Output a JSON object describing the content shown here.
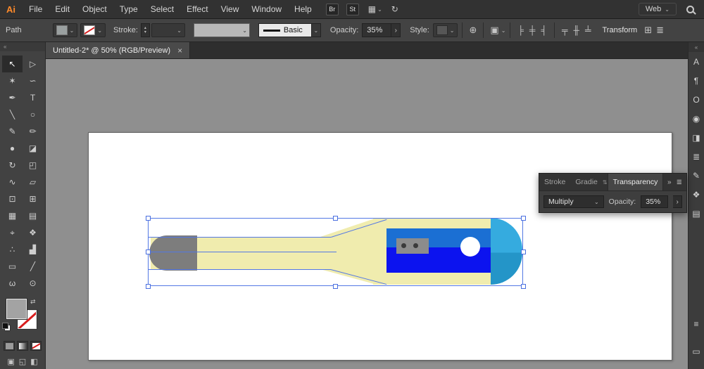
{
  "colors": {
    "ui_dark": "#323232",
    "ui_mid": "#434343",
    "canvas_bg": "#8f8f8f",
    "logo_orange": "#ff8a2a",
    "selection_blue": "#5378e4"
  },
  "glyphs": {
    "chevron_down": "⌄",
    "chevron_right": "›",
    "collapse_left": "«",
    "overflow_right": "»",
    "panel_menu": "≣",
    "up_arrow": "▴",
    "down_arrow": "▾",
    "swap": "⇄",
    "grid": "▦",
    "sync": "↻",
    "globe": "⊕",
    "select_similar": "▣",
    "tab_scroll": "⇅",
    "align": [
      "╞",
      "╪",
      "╡",
      "╤",
      "╫",
      "╧"
    ],
    "transform_grid": "⊞",
    "draw_modes": [
      "▣",
      "◱",
      "◧"
    ]
  },
  "menubar": {
    "logo": "Ai",
    "items": [
      "File",
      "Edit",
      "Object",
      "Type",
      "Select",
      "Effect",
      "View",
      "Window",
      "Help"
    ],
    "bridge_label": "Br",
    "stock_label": "St",
    "workspace": "Web"
  },
  "controlbar": {
    "selection_type": "Path",
    "stroke_label": "Stroke:",
    "brush_name": "Basic",
    "opacity_label": "Opacity:",
    "opacity_value": "35%",
    "style_label": "Style:",
    "transform_label": "Transform"
  },
  "tabbar": {
    "title": "Untitled-2* @ 50% (RGB/Preview)",
    "close": "×"
  },
  "toolbar": {
    "tools": [
      {
        "name": "selection-tool",
        "glyph": "↖"
      },
      {
        "name": "direct-selection-tool",
        "glyph": "▷"
      },
      {
        "name": "magic-wand-tool",
        "glyph": "✶"
      },
      {
        "name": "lasso-tool",
        "glyph": "∽"
      },
      {
        "name": "pen-tool",
        "glyph": "✒"
      },
      {
        "name": "type-tool",
        "glyph": "T"
      },
      {
        "name": "line-segment-tool",
        "glyph": "╲"
      },
      {
        "name": "ellipse-tool",
        "glyph": "○"
      },
      {
        "name": "paintbrush-tool",
        "glyph": "✎"
      },
      {
        "name": "pencil-tool",
        "glyph": "✏"
      },
      {
        "name": "blob-brush-tool",
        "glyph": "●"
      },
      {
        "name": "eraser-tool",
        "glyph": "◪"
      },
      {
        "name": "rotate-tool",
        "glyph": "↻"
      },
      {
        "name": "scale-tool",
        "glyph": "◰"
      },
      {
        "name": "width-tool",
        "glyph": "∿"
      },
      {
        "name": "free-transform-tool",
        "glyph": "▱"
      },
      {
        "name": "shape-builder-tool",
        "glyph": "⊡"
      },
      {
        "name": "perspective-grid-tool",
        "glyph": "⊞"
      },
      {
        "name": "mesh-tool",
        "glyph": "▦"
      },
      {
        "name": "gradient-tool",
        "glyph": "▤"
      },
      {
        "name": "eyedropper-tool",
        "glyph": "⌖"
      },
      {
        "name": "blend-tool",
        "glyph": "❖"
      },
      {
        "name": "symbol-sprayer-tool",
        "glyph": "∴"
      },
      {
        "name": "column-graph-tool",
        "glyph": "▟"
      },
      {
        "name": "artboard-tool",
        "glyph": "▭"
      },
      {
        "name": "slice-tool",
        "glyph": "╱"
      },
      {
        "name": "hand-tool",
        "glyph": "ω"
      },
      {
        "name": "zoom-tool",
        "glyph": "⊙"
      }
    ]
  },
  "right_dock": {
    "top_icons": [
      {
        "name": "character-panel-icon",
        "glyph": "A"
      },
      {
        "name": "paragraph-panel-icon",
        "glyph": "¶"
      },
      {
        "name": "opentype-panel-icon",
        "glyph": "O"
      },
      {
        "name": "appearance-panel-icon",
        "glyph": "◉"
      },
      {
        "name": "graphic-styles-panel-icon",
        "glyph": "◨"
      },
      {
        "name": "stroke-panel-icon",
        "glyph": "≣"
      },
      {
        "name": "brushes-panel-icon",
        "glyph": "✎"
      },
      {
        "name": "symbols-panel-icon",
        "glyph": "❖"
      },
      {
        "name": "gradient-panel-icon",
        "glyph": "▤"
      }
    ],
    "bottom_icons": [
      {
        "name": "layers-panel-icon",
        "glyph": "≡"
      },
      {
        "name": "artboards-panel-icon",
        "glyph": "▭"
      }
    ]
  },
  "transparency_panel": {
    "tabs": [
      "Stroke",
      "Gradie",
      "Transparency"
    ],
    "active_tab": "Transparency",
    "blend_mode": "Multiply",
    "opacity_label": "Opacity:",
    "opacity_value": "35%"
  },
  "artwork": {
    "subject": "Selected horizontal bottle/thermometer vector illustration on white artboard",
    "body_color": "#f0ecae",
    "left_cap_color": "#7d7d7d",
    "stripe_top_color": "#1b6fd3",
    "stripe_bottom_color": "#0c13ef",
    "right_cap_color": "#35abdf",
    "right_cap_shade_color": "#2495c8",
    "widget_color": "#8c8c8c",
    "widget_dot_color": "#3a3a3a",
    "circle_color": "#ffffff",
    "selection_color": "#5378e4"
  }
}
